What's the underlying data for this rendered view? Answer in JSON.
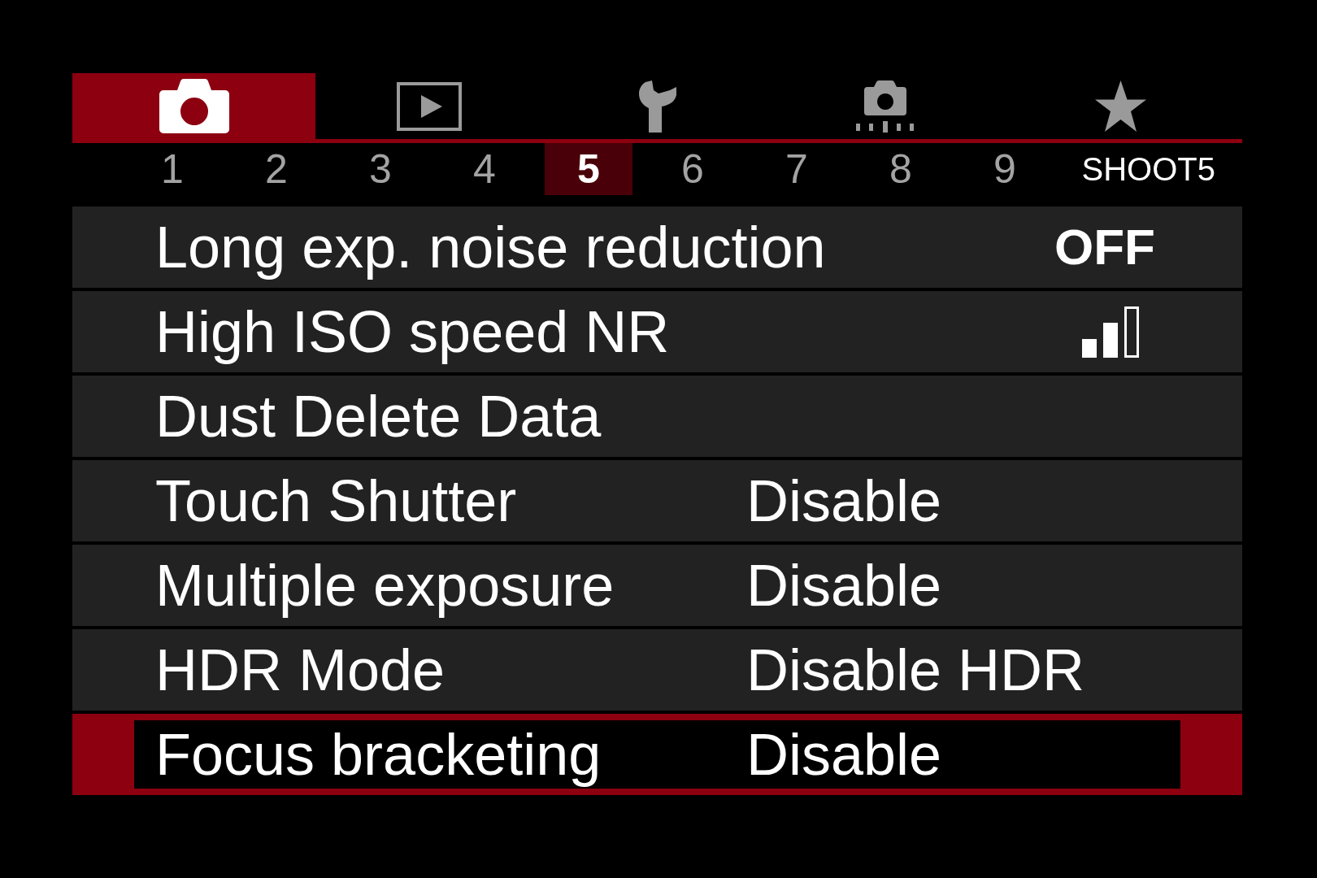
{
  "tabs": [
    {
      "kind": "shooting",
      "selected": true
    },
    {
      "kind": "playback",
      "selected": false
    },
    {
      "kind": "setup",
      "selected": false
    },
    {
      "kind": "custom",
      "selected": false
    },
    {
      "kind": "mymenu",
      "selected": false
    }
  ],
  "pages": [
    {
      "label": "1",
      "selected": false
    },
    {
      "label": "2",
      "selected": false
    },
    {
      "label": "3",
      "selected": false
    },
    {
      "label": "4",
      "selected": false
    },
    {
      "label": "5",
      "selected": true
    },
    {
      "label": "6",
      "selected": false
    },
    {
      "label": "7",
      "selected": false
    },
    {
      "label": "8",
      "selected": false
    },
    {
      "label": "9",
      "selected": false
    }
  ],
  "page_title": "SHOOT5",
  "menu_items": [
    {
      "label": "Long exp. noise reduction",
      "kind": "right",
      "value": "OFF",
      "selected": false
    },
    {
      "label": "High ISO speed NR",
      "kind": "meter",
      "level": 0.67,
      "selected": false
    },
    {
      "label": "Dust Delete Data",
      "kind": "plain",
      "selected": false
    },
    {
      "label": "Touch Shutter",
      "kind": "inline",
      "value": "Disable",
      "selected": false
    },
    {
      "label": "Multiple exposure",
      "kind": "inline",
      "value": "Disable",
      "selected": false
    },
    {
      "label": "HDR Mode",
      "kind": "inline",
      "value": "Disable HDR",
      "selected": false
    },
    {
      "label": "Focus bracketing",
      "kind": "inline",
      "value": "Disable",
      "selected": true
    }
  ]
}
